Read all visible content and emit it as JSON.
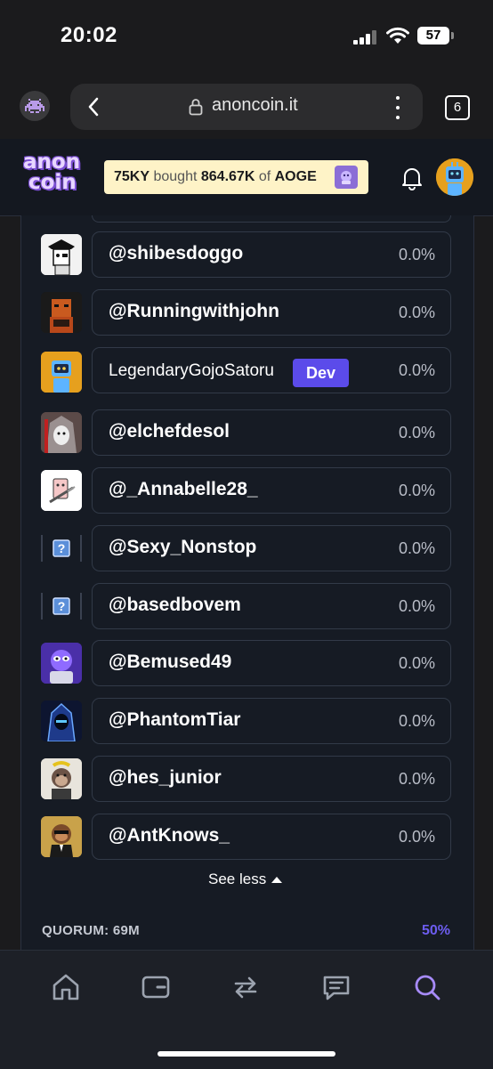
{
  "status_bar": {
    "time": "20:02",
    "battery": "57"
  },
  "browser": {
    "url": "anoncoin.it",
    "tab_count": "6"
  },
  "header": {
    "logo_line1": "anon",
    "logo_line2": "coin",
    "ticker": {
      "buyer": "75KY",
      "verb": "bought",
      "amount": "864.67K",
      "preposition": "of",
      "token": "AOGE"
    }
  },
  "holders": [
    {
      "name": "@shibesdoggo",
      "pct": "0.0%",
      "icon": "pirate-ape-icon"
    },
    {
      "name": "@Runningwithjohn",
      "pct": "0.0%",
      "icon": "smoking-king-icon"
    },
    {
      "name": "LegendaryGojoSatoru",
      "pct": "0.0%",
      "badge": "Dev",
      "icon": "robot-avatar-icon"
    },
    {
      "name": "@elchefdesol",
      "pct": "0.0%",
      "icon": "hooded-figure-icon"
    },
    {
      "name": "@_Annabelle28_",
      "pct": "0.0%",
      "icon": "syringe-cartoon-icon"
    },
    {
      "name": "@Sexy_Nonstop",
      "pct": "0.0%",
      "icon": "question-placeholder-icon"
    },
    {
      "name": "@basedbovem",
      "pct": "0.0%",
      "icon": "question-placeholder-icon"
    },
    {
      "name": "@Bemused49",
      "pct": "0.0%",
      "icon": "purple-pepe-icon"
    },
    {
      "name": "@PhantomTiar",
      "pct": "0.0%",
      "icon": "blue-hood-icon"
    },
    {
      "name": "@hes_junior",
      "pct": "0.0%",
      "icon": "banana-ape-icon"
    },
    {
      "name": "@AntKnows_",
      "pct": "0.0%",
      "icon": "monkey-suit-icon"
    }
  ],
  "see_less_label": "See less",
  "quorum": {
    "label": "QUORUM: 69M",
    "pct": "50%"
  },
  "colors": {
    "accent": "#5b4bea",
    "ticker_bg": "#fef3c7",
    "panel_bg": "#161b24"
  }
}
